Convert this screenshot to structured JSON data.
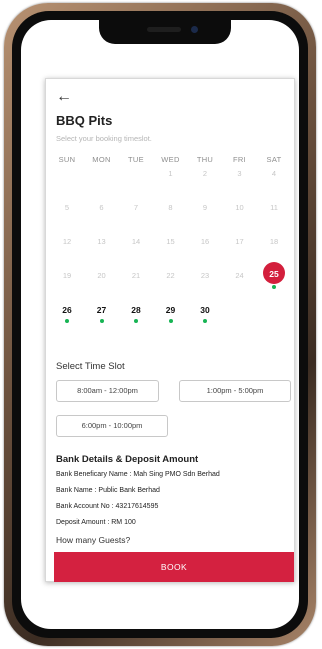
{
  "page": {
    "back_label": "←",
    "title": "BBQ Pits",
    "subtitle": "Select your booking timeslot."
  },
  "calendar": {
    "weekdays": [
      "SUN",
      "MON",
      "TUE",
      "WED",
      "THU",
      "FRI",
      "SAT"
    ],
    "weeks": [
      [
        {
          "d": ""
        },
        {
          "d": ""
        },
        {
          "d": ""
        },
        {
          "d": "1"
        },
        {
          "d": "2"
        },
        {
          "d": "3"
        },
        {
          "d": "4"
        }
      ],
      [
        {
          "d": "5"
        },
        {
          "d": "6"
        },
        {
          "d": "7"
        },
        {
          "d": "8"
        },
        {
          "d": "9"
        },
        {
          "d": "10"
        },
        {
          "d": "11"
        }
      ],
      [
        {
          "d": "12"
        },
        {
          "d": "13"
        },
        {
          "d": "14"
        },
        {
          "d": "15"
        },
        {
          "d": "16"
        },
        {
          "d": "17"
        },
        {
          "d": "18"
        }
      ],
      [
        {
          "d": "19"
        },
        {
          "d": "20"
        },
        {
          "d": "21"
        },
        {
          "d": "22"
        },
        {
          "d": "23"
        },
        {
          "d": "24"
        },
        {
          "d": "25",
          "avail": true,
          "selected": true
        }
      ],
      [
        {
          "d": "26",
          "avail": true
        },
        {
          "d": "27",
          "avail": true
        },
        {
          "d": "28",
          "avail": true
        },
        {
          "d": "29",
          "avail": true
        },
        {
          "d": "30",
          "avail": true
        },
        {
          "d": ""
        },
        {
          "d": ""
        }
      ]
    ],
    "available_dot_color": "#17b454",
    "selected_color": "#d31f3c"
  },
  "time_slot": {
    "label": "Select Time Slot",
    "slots": [
      "8:00am - 12:00pm",
      "1:00pm - 5:00pm",
      "6:00pm - 10:00pm"
    ]
  },
  "bank": {
    "title": "Bank Details & Deposit Amount",
    "lines": [
      "Bank Beneficary Name : Mah Sing PMO Sdn Berhad",
      "Bank Name : Public Bank Berhad",
      "Bank Account No : 43217614595",
      "Deposit Amount : RM 100"
    ]
  },
  "guests_label": "How many Guests?",
  "book_label": "BOOK",
  "accent_color": "#d42140"
}
